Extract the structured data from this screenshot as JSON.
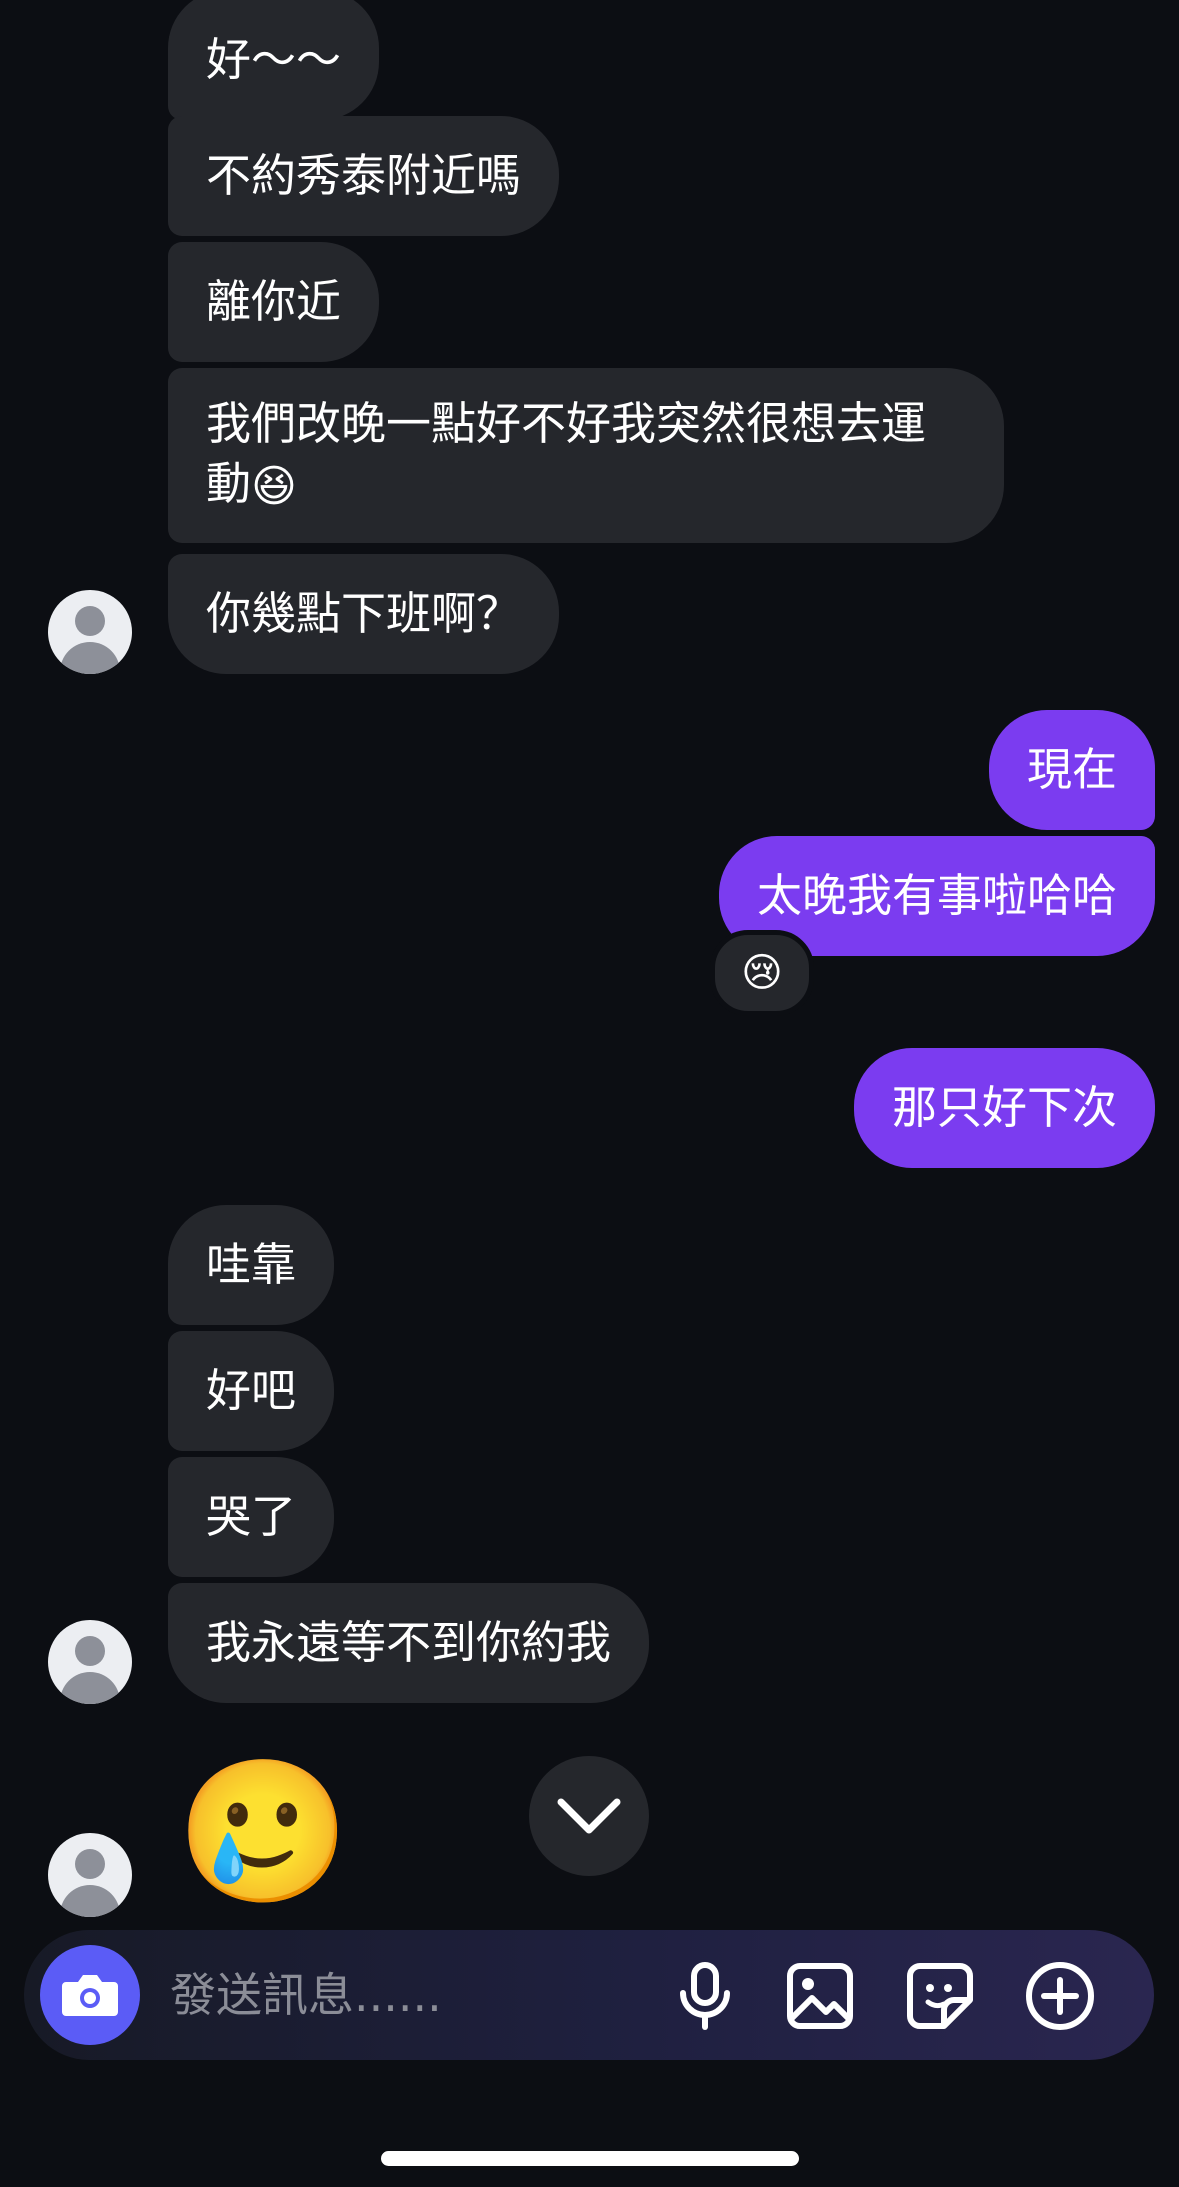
{
  "messages": {
    "m1": "好～～",
    "m2": "不約秀泰附近嗎",
    "m3": "離你近",
    "m4_text": "我們改晚一點好不好我突然很想去運動",
    "m4_emoji": "😆",
    "m5": "你幾點下班啊？",
    "m6": "現在",
    "m7": "太晚我有事啦哈哈",
    "m7_reaction": "😢",
    "m8": "那只好下次",
    "m9": "哇靠",
    "m10": "好吧",
    "m11": "哭了",
    "m12": "我永遠等不到你約我",
    "m13_emoji": "🥲"
  },
  "composer": {
    "placeholder": "發送訊息......"
  },
  "icons": {
    "avatar": "default-avatar-icon",
    "scroll": "chevron-down-icon",
    "camera": "camera-icon",
    "mic": "microphone-icon",
    "gallery": "image-icon",
    "sticker": "sticker-icon",
    "more": "plus-circle-icon"
  },
  "colors": {
    "background": "#0c0e13",
    "incoming_bubble": "#25272c",
    "outgoing_bubble": "#7b3cf0",
    "camera_button": "#5b5cf6"
  }
}
